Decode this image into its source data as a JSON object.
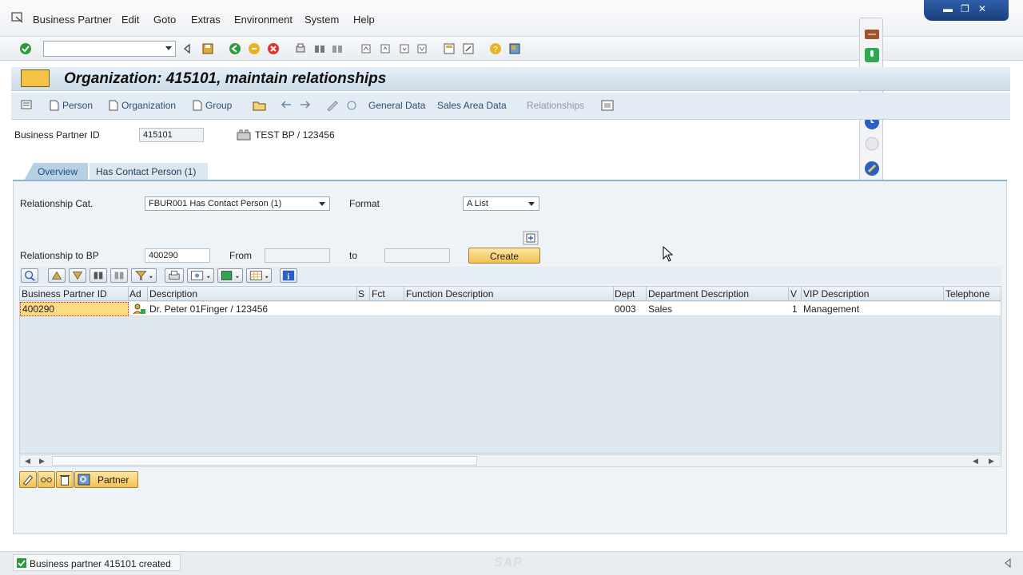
{
  "menu": {
    "items": [
      "Business Partner",
      "Edit",
      "Goto",
      "Extras",
      "Environment",
      "System",
      "Help"
    ]
  },
  "window_controls": {
    "minimize": "▬",
    "restore": "❐",
    "close": "✕"
  },
  "title": {
    "text": "Organization: 415101, maintain relationships"
  },
  "app_toolbar": {
    "person": "Person",
    "organization": "Organization",
    "group": "Group",
    "general_data": "General Data",
    "sales_area_data": "Sales Area Data",
    "relationships": "Relationships"
  },
  "header": {
    "bp_id_label": "Business Partner ID",
    "bp_id_value": "415101",
    "bp_name": "TEST BP / 123456"
  },
  "tabs": {
    "overview": "Overview",
    "contact": "Has Contact Person (1)"
  },
  "form": {
    "rel_cat_label": "Relationship Cat.",
    "rel_cat_value": "FBUR001 Has Contact Person (1)",
    "format_label": "Format",
    "format_value": "A List",
    "rel_to_bp_label": "Relationship to BP",
    "rel_to_bp_value": "400290",
    "from_label": "From",
    "to_label": "to",
    "create_button": "Create"
  },
  "grid": {
    "columns": [
      "Business Partner ID",
      "Ad",
      "Description",
      "S",
      "Fct",
      "Function Description",
      "Dept",
      "Department Description",
      "V",
      "VIP Description",
      "Telephone"
    ],
    "rows": [
      {
        "bp_id": "400290",
        "description": "Dr. Peter 01Finger / 123456",
        "dept": "0003",
        "dept_desc": "Sales",
        "vip": "1",
        "vip_desc": "Management"
      }
    ]
  },
  "bottom": {
    "partner_button": "Partner"
  },
  "status": {
    "message": "Business partner 415101 created",
    "logo": "SAP"
  },
  "colors": {
    "accent_yellow": "#f3c052",
    "title_bg": "#d5e3ef",
    "status_ok": "#2e9b3a"
  }
}
